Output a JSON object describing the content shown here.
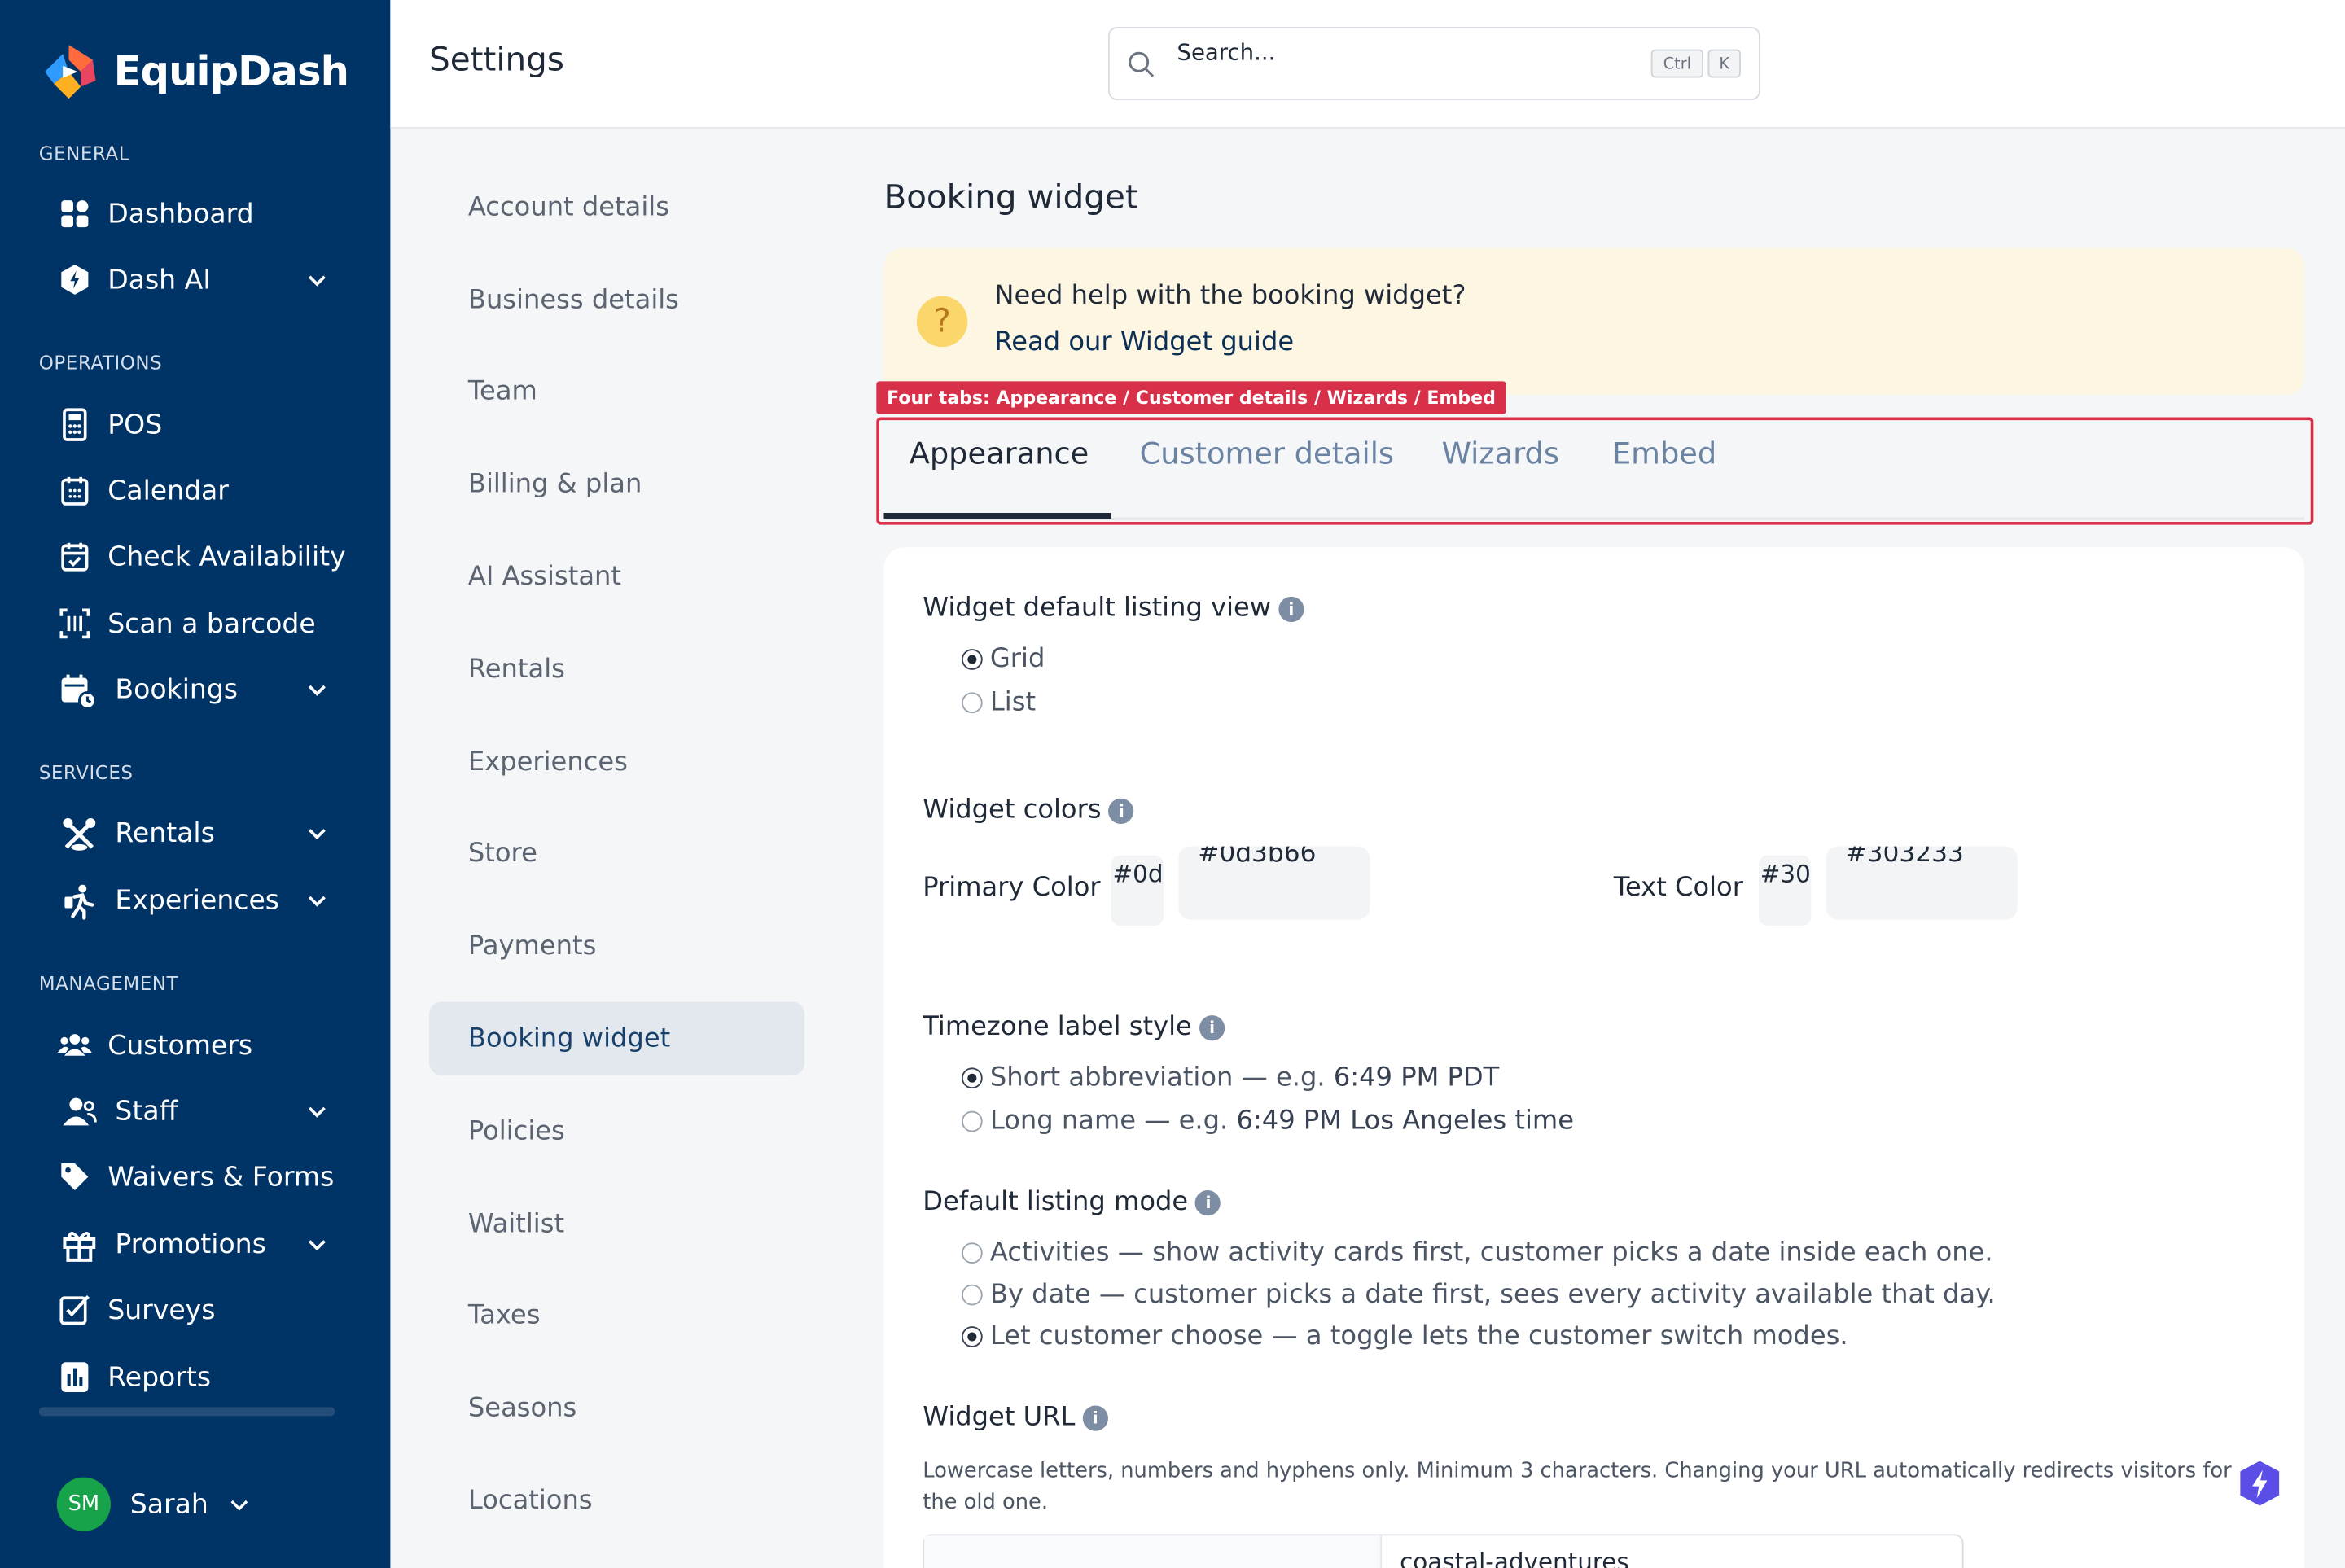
{
  "app": {
    "name": "EquipDash"
  },
  "sidebar": {
    "sections": {
      "general": "GENERAL",
      "operations": "OPERATIONS",
      "services": "SERVICES",
      "management": "MANAGEMENT"
    },
    "items": [
      {
        "label": "Dashboard",
        "icon": "grid-icon"
      },
      {
        "label": "Dash AI",
        "icon": "ai-icon",
        "expandable": true
      },
      {
        "label": "POS",
        "icon": "pos-terminal-icon"
      },
      {
        "label": "Calendar",
        "icon": "calendar-icon"
      },
      {
        "label": "Check Availability",
        "icon": "calendar-check-icon"
      },
      {
        "label": "Scan a barcode",
        "icon": "barcode-scan-icon"
      },
      {
        "label": "Bookings",
        "icon": "bookings-icon",
        "expandable": true
      },
      {
        "label": "Rentals",
        "icon": "rentals-icon",
        "expandable": true
      },
      {
        "label": "Experiences",
        "icon": "experiences-icon",
        "expandable": true
      },
      {
        "label": "Customers",
        "icon": "customers-icon"
      },
      {
        "label": "Staff",
        "icon": "staff-icon",
        "expandable": true
      },
      {
        "label": "Waivers & Forms",
        "icon": "tag-icon"
      },
      {
        "label": "Promotions",
        "icon": "gift-icon",
        "expandable": true
      },
      {
        "label": "Surveys",
        "icon": "survey-icon"
      },
      {
        "label": "Reports",
        "icon": "reports-icon"
      }
    ],
    "user": {
      "initials": "SM",
      "name": "Sarah"
    }
  },
  "header": {
    "title": "Settings",
    "search": {
      "placeholder": "Search...",
      "shortcut": [
        "Ctrl",
        "K"
      ]
    }
  },
  "settings_nav": {
    "items": [
      "Account details",
      "Business details",
      "Team",
      "Billing & plan",
      "AI Assistant",
      "Rentals",
      "Experiences",
      "Store",
      "Payments",
      "Booking widget",
      "Policies",
      "Waitlist",
      "Taxes",
      "Seasons",
      "Locations"
    ],
    "active": "Booking widget"
  },
  "main": {
    "heading": "Booking widget",
    "help": {
      "question": "Need help with the booking widget?",
      "link": "Read our Widget guide"
    },
    "annotation": "Four tabs: Appearance / Customer details / Wizards / Embed",
    "tabs": [
      "Appearance",
      "Customer details",
      "Wizards",
      "Embed"
    ],
    "active_tab": "Appearance",
    "listing_view": {
      "label": "Widget default listing view",
      "options": [
        "Grid",
        "List"
      ],
      "selected": "Grid"
    },
    "colors": {
      "label": "Widget colors",
      "primary": {
        "label": "Primary Color",
        "swatch_text": "#0d",
        "value": "#0d3b66"
      },
      "text": {
        "label": "Text Color",
        "swatch_text": "#30",
        "value": "#303233"
      }
    },
    "timezone": {
      "label": "Timezone label style",
      "options": [
        {
          "name": "Short abbreviation",
          "sep": " — e.g. ",
          "example": "6:49 PM PDT"
        },
        {
          "name": "Long name",
          "sep": " — e.g. ",
          "example": "6:49 PM Los Angeles time"
        }
      ],
      "selected": 0
    },
    "listing_mode": {
      "label": "Default listing mode",
      "options": [
        {
          "name": "Activities",
          "desc": " — show activity cards first, customer picks a date inside each one."
        },
        {
          "name": "By date",
          "desc": " — customer picks a date first, sees every activity available that day."
        },
        {
          "name": "Let customer choose",
          "desc": " — a toggle lets the customer switch modes."
        }
      ],
      "selected": 2
    },
    "widget_url": {
      "label": "Widget URL",
      "help": "Lowercase letters, numbers and hyphens only. Minimum 3 characters. Changing your URL automatically redirects visitors for the old one.",
      "value": "coastal-adventures"
    }
  },
  "colors": {
    "sidebar_bg": "#003366",
    "accent": "#17406b",
    "annotation": "#d9304a",
    "help_bg": "#fdf6e3"
  }
}
